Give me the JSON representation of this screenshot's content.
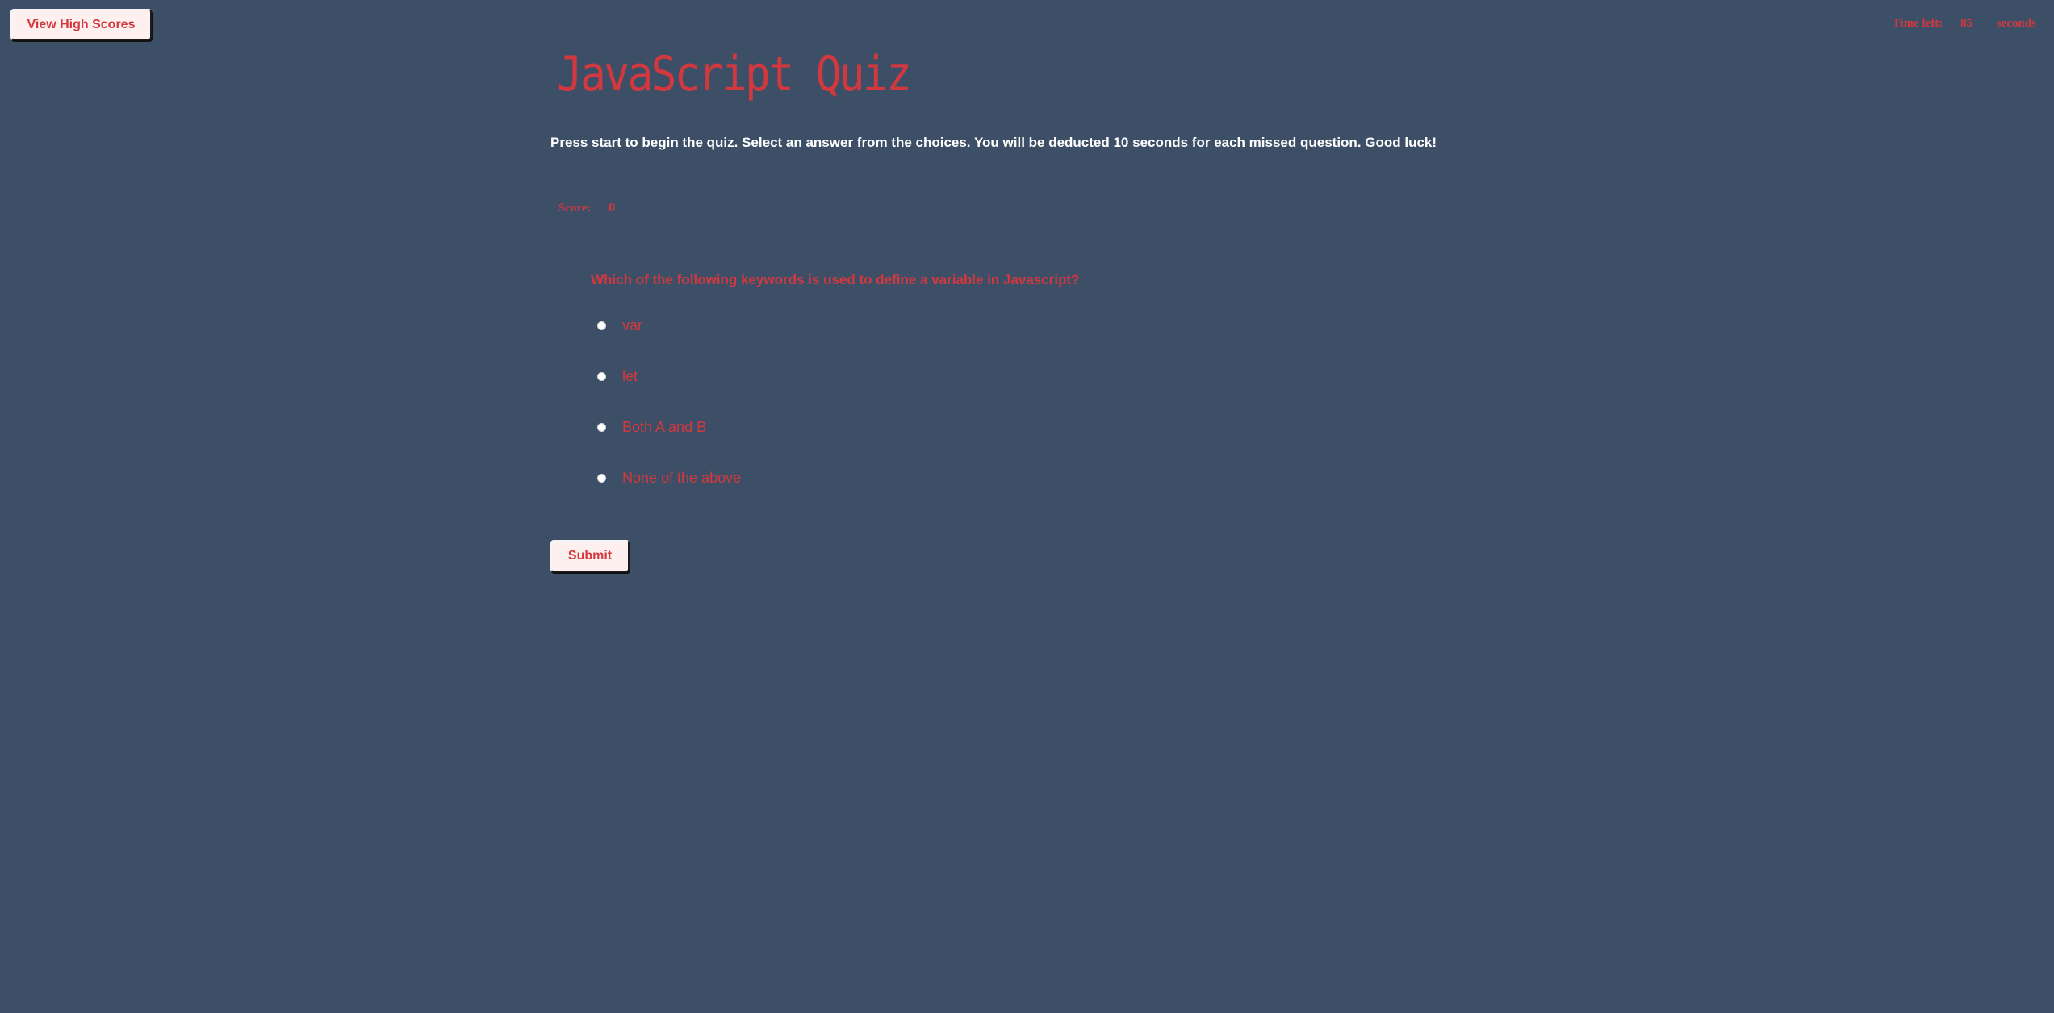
{
  "header": {
    "high_scores_label": "View High Scores",
    "timer": {
      "label": "Time left:",
      "value": "85",
      "unit": "seconds"
    }
  },
  "main": {
    "title": "JavaScript Quiz",
    "instructions": "Press start to begin the quiz. Select an answer from the choices. You will be deducted 10 seconds for each missed question. Good luck!",
    "score": {
      "label": "Score:",
      "value": "0"
    },
    "question": "Which of the following keywords is used to define a variable in Javascript?",
    "choices": [
      {
        "label": "var"
      },
      {
        "label": "let"
      },
      {
        "label": "Both A and B"
      },
      {
        "label": "None of the above"
      }
    ],
    "submit_label": "Submit"
  },
  "colors": {
    "background": "#3d4f66",
    "accent": "#d4383f",
    "button_bg": "#fdf0ee",
    "text_light": "#ffffff"
  }
}
